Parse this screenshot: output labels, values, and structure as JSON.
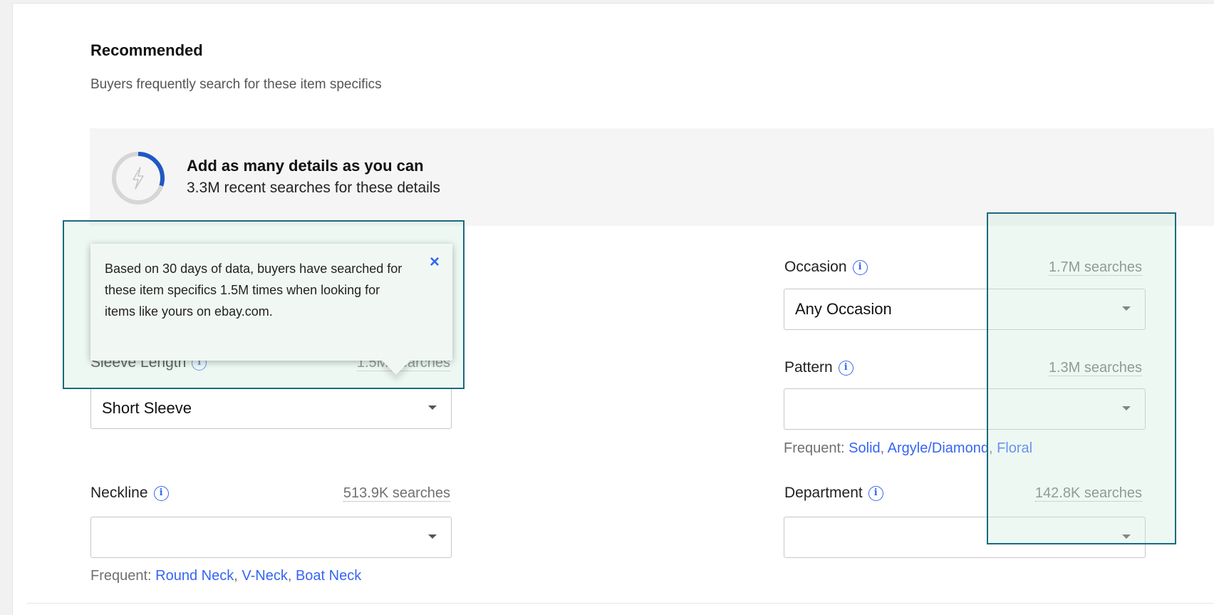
{
  "section": {
    "title": "Recommended",
    "subtitle": "Buyers frequently search for these item specifics"
  },
  "banner": {
    "title": "Add as many details as you can",
    "subtitle": "3.3M recent searches for these details",
    "icon": "lightning-bolt-icon",
    "progress": 0.3
  },
  "tooltip": {
    "text": "Based on 30 days of data, buyers have searched for these item specifics 1.5M times when looking for items like yours on ebay.com.",
    "close": "×"
  },
  "fields": {
    "sleeve_length": {
      "label": "Sleeve Length",
      "searches": "1.5M searches",
      "value": "Short Sleeve"
    },
    "neckline": {
      "label": "Neckline",
      "searches": "513.9K searches",
      "value": ""
    },
    "occasion": {
      "label": "Occasion",
      "searches": "1.7M searches",
      "value": "Any Occasion"
    },
    "pattern": {
      "label": "Pattern",
      "searches": "1.3M searches",
      "value": ""
    },
    "department": {
      "label": "Department",
      "searches": "142.8K searches",
      "value": ""
    }
  },
  "frequent": {
    "prefix": "Frequent:",
    "neckline": [
      "Round Neck",
      "V-Neck",
      "Boat Neck"
    ],
    "pattern": [
      "Solid",
      "Argyle/Diamond",
      "Floral"
    ]
  },
  "colors": {
    "link": "#3665f3",
    "highlight_border": "#1a6a7f",
    "progress_ring": "#1f58c4"
  }
}
